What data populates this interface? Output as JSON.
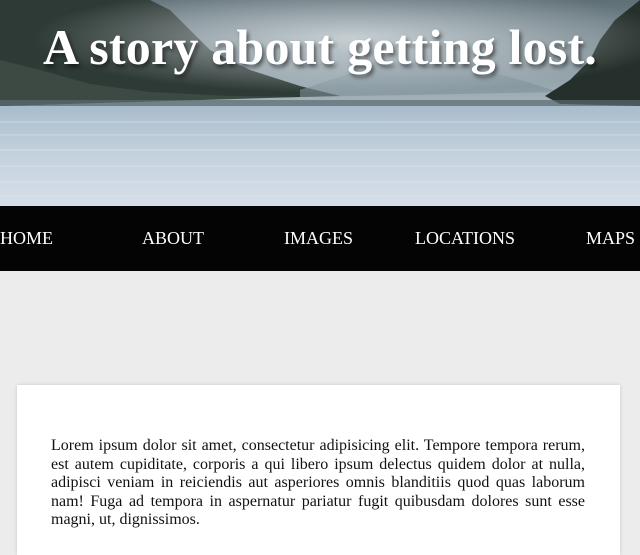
{
  "hero": {
    "title": "A story about getting lost.",
    "image": "misty-lake-landscape"
  },
  "nav": {
    "items": [
      {
        "label": "HOME"
      },
      {
        "label": "ABOUT"
      },
      {
        "label": "IMAGES"
      },
      {
        "label": "LOCATIONS"
      },
      {
        "label": "MAPS"
      }
    ]
  },
  "article": {
    "body": "Lorem ipsum dolor sit amet, consectetur adipisicing elit. Tempore tempora rerum, est autem cupiditate, corporis a qui libero ipsum delectus quidem dolor at nulla, adipisci veniam in reiciendis aut asperiores omnis blanditiis quod quas laborum nam! Fuga ad tempora in aspernatur pariatur fugit quibusdam dolores sunt esse magni, ut, dignissimos."
  },
  "colors": {
    "navbar": "#040404",
    "page_background": "#ececec",
    "card": "#ffffff",
    "hero_title": "#ffffff"
  }
}
